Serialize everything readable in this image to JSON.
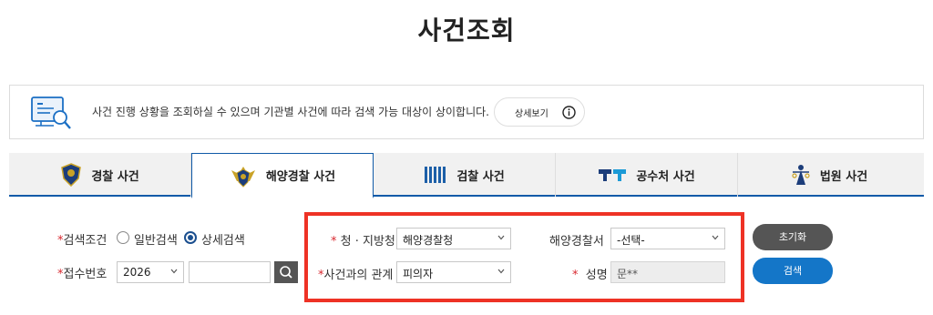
{
  "page": {
    "title": "사건조회"
  },
  "info": {
    "text": "사건 진행 상황을 조회하실 수 있으며 기관별 사건에 따라 검색 가능 대상이 상이합니다.",
    "detail_button_label": "상세보기"
  },
  "tabs": [
    {
      "label": "경찰 사건",
      "icon": "police-badge-icon"
    },
    {
      "label": "해양경찰 사건",
      "icon": "coast-guard-emblem-icon",
      "active": true
    },
    {
      "label": "검찰 사건",
      "icon": "prosecution-logo-icon"
    },
    {
      "label": "공수처 사건",
      "icon": "cio-logo-icon"
    },
    {
      "label": "법원 사건",
      "icon": "court-logo-icon"
    }
  ],
  "form": {
    "search_condition": {
      "required_mark": "*",
      "label": "검색조건",
      "options": [
        "일반검색",
        "상세검색"
      ],
      "selected": "상세검색"
    },
    "receipt_number": {
      "required_mark": "*",
      "label": "접수번호",
      "year_value": "2026",
      "number_value": ""
    },
    "agency": {
      "required_mark": "*",
      "label": "청 · 지방청",
      "value": "해양경찰청"
    },
    "station": {
      "label": "해양경찰서",
      "value": "-선택-"
    },
    "relation": {
      "required_mark": "*",
      "label": "사건과의 관계",
      "value": "피의자"
    },
    "name": {
      "required_mark": "*",
      "label": "성명",
      "value": "문**"
    }
  },
  "buttons": {
    "reset_label": "초기화",
    "search_label": "검색"
  },
  "colors": {
    "accent_blue": "#1476c8",
    "tab_border": "#0f5aa8",
    "highlight_red": "#ee3225",
    "required_red": "#d8282f",
    "dark_button": "#555555"
  }
}
